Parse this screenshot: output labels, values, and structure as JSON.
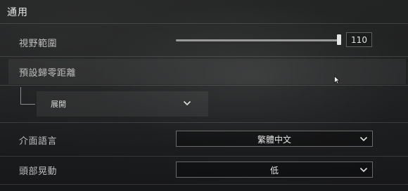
{
  "section": {
    "title": "通用"
  },
  "settings": {
    "fov": {
      "label": "視野範圍",
      "value": "110",
      "slider_fraction": 0.99
    },
    "default_zero": {
      "label": "預設歸零距離",
      "sub_select": {
        "value": "展開"
      }
    },
    "language": {
      "label": "介面語言",
      "value": "繁體中文"
    },
    "head_bob": {
      "label": "頭部晃動",
      "value": "低"
    }
  },
  "icons": {
    "chevron": "chevron-down-icon",
    "cursor": "mouse-cursor-icon"
  },
  "colors": {
    "background": "#1a1b1c",
    "text": "#d8d8d8",
    "border": "#6a6a6a"
  }
}
